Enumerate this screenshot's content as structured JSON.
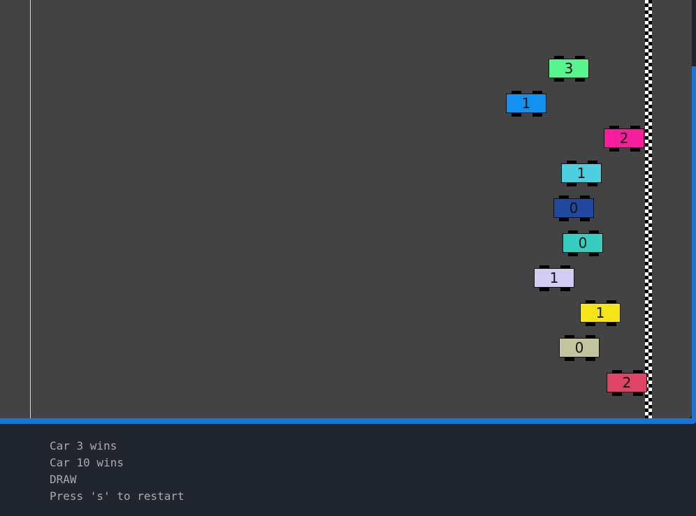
{
  "console": {
    "lines": [
      "Car 3 wins",
      "Car 10 wins",
      "DRAW",
      "Press 's' to restart"
    ]
  },
  "colors": {
    "track": "#434343",
    "console_bg": "#21252e",
    "accent": "#1976d2",
    "console_text": "#a8abb1"
  },
  "cars": [
    {
      "score": "3",
      "color": "#58f58f"
    },
    {
      "score": "1",
      "color": "#1291f0"
    },
    {
      "score": "2",
      "color": "#f71e9d"
    },
    {
      "score": "1",
      "color": "#4ecfe0"
    },
    {
      "score": "0",
      "color": "#21489e"
    },
    {
      "score": "0",
      "color": "#36cdc0"
    },
    {
      "score": "1",
      "color": "#d1cdf4"
    },
    {
      "score": "1",
      "color": "#f5e41a"
    },
    {
      "score": "0",
      "color": "#c3c59e"
    },
    {
      "score": "2",
      "color": "#de4466"
    }
  ]
}
